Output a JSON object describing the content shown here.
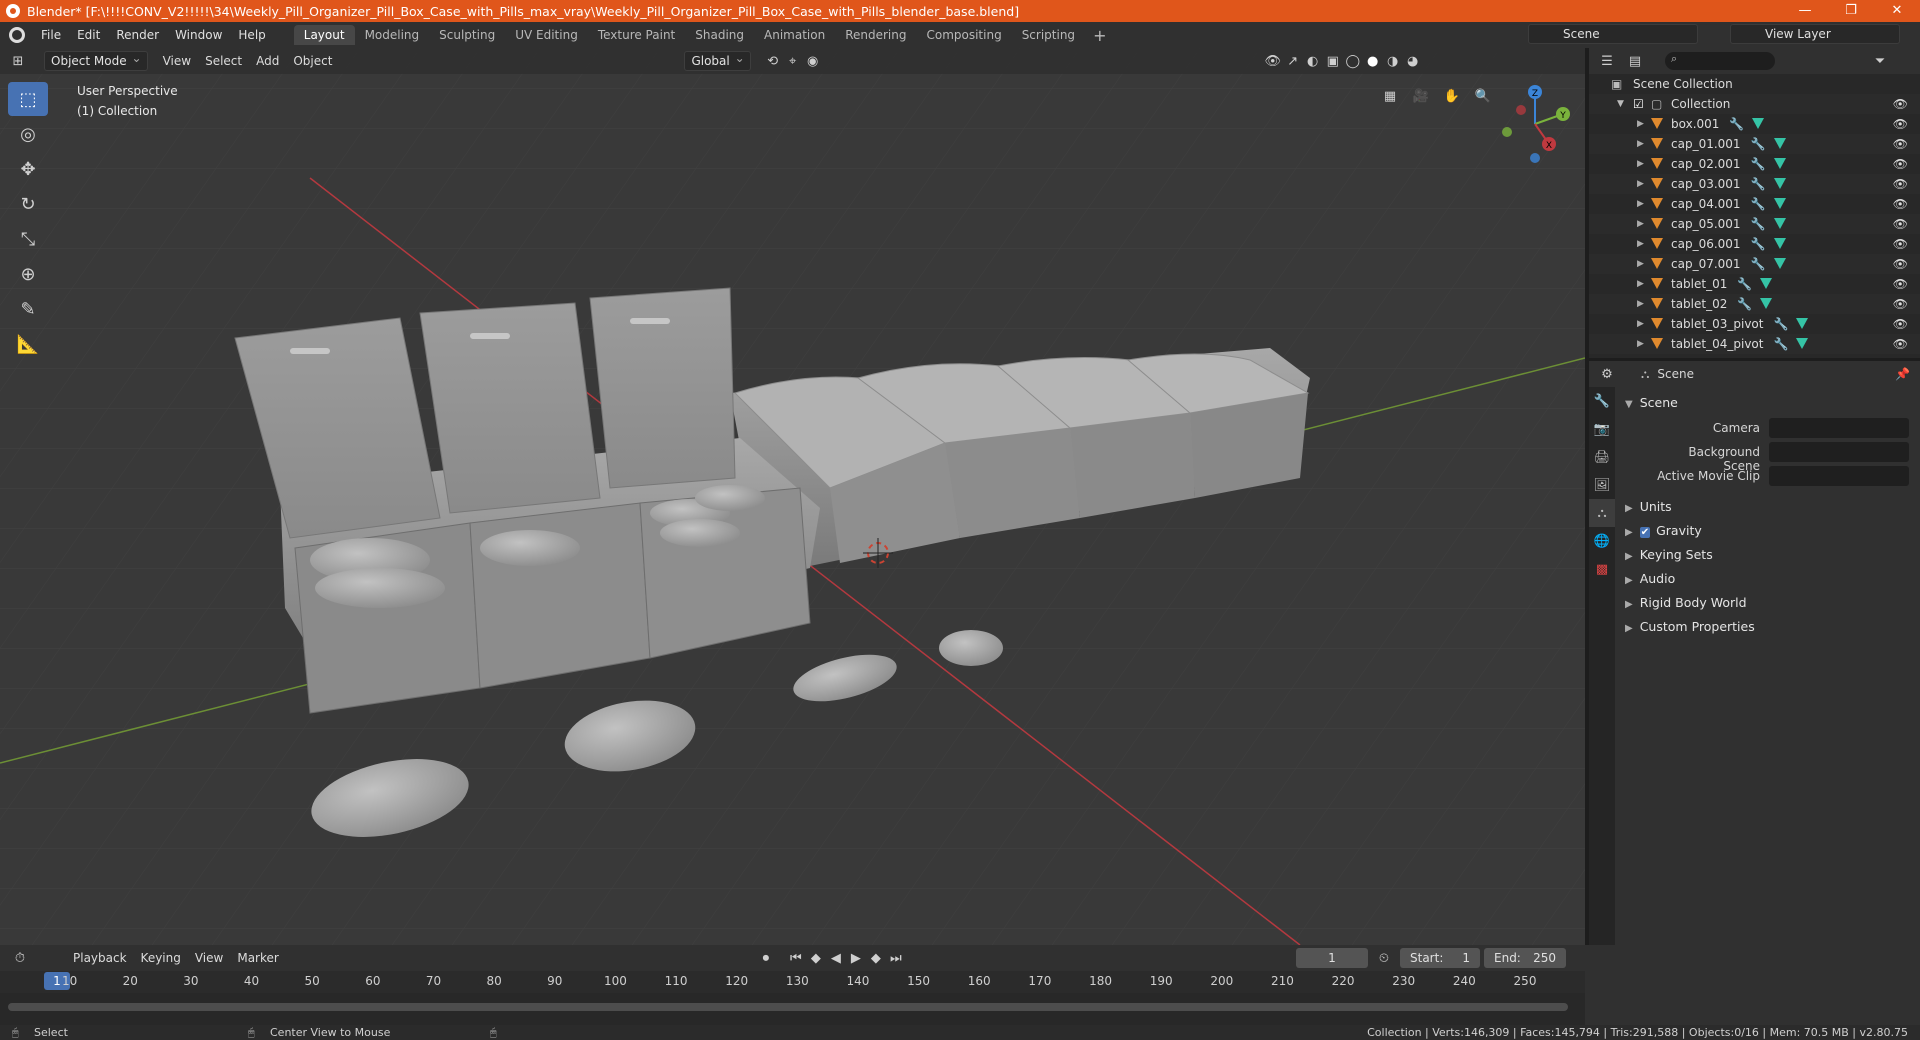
{
  "window": {
    "title": "Blender* [F:\\!!!!CONV_V2!!!!!\\34\\Weekly_Pill_Organizer_Pill_Box_Case_with_Pills_max_vray\\Weekly_Pill_Organizer_Pill_Box_Case_with_Pills_blender_base.blend]",
    "minimize": "—",
    "maximize": "❐",
    "close": "✕"
  },
  "menus": [
    "File",
    "Edit",
    "Render",
    "Window",
    "Help"
  ],
  "workspaces": [
    "Layout",
    "Modeling",
    "Sculpting",
    "UV Editing",
    "Texture Paint",
    "Shading",
    "Animation",
    "Rendering",
    "Compositing",
    "Scripting"
  ],
  "active_workspace": "Layout",
  "scene_name": "Scene",
  "view_layer": "View Layer",
  "viewport": {
    "mode": "Object Mode",
    "menus": [
      "View",
      "Select",
      "Add",
      "Object"
    ],
    "orientation": "Global",
    "info_line1": "User Perspective",
    "info_line2": "(1) Collection",
    "gizmo": {
      "x": "X",
      "y": "Y",
      "z": "Z"
    }
  },
  "tools": [
    {
      "name": "select-box-tool",
      "glyph": "⬚"
    },
    {
      "name": "cursor-tool",
      "glyph": "◎"
    },
    {
      "name": "move-tool",
      "glyph": "✥"
    },
    {
      "name": "rotate-tool",
      "glyph": "↻"
    },
    {
      "name": "scale-tool",
      "glyph": "⤡"
    },
    {
      "name": "transform-tool",
      "glyph": "⊕"
    },
    {
      "name": "annotate-tool",
      "glyph": "✎"
    },
    {
      "name": "measure-tool",
      "glyph": "📐"
    }
  ],
  "outliner": {
    "root": "Scene Collection",
    "collection": "Collection",
    "objects": [
      "box.001",
      "cap_01.001",
      "cap_02.001",
      "cap_03.001",
      "cap_04.001",
      "cap_05.001",
      "cap_06.001",
      "cap_07.001",
      "tablet_01",
      "tablet_02",
      "tablet_03_pivot",
      "tablet_04_pivot"
    ]
  },
  "properties": {
    "context": "Scene",
    "panel": "Scene",
    "camera_label": "Camera",
    "background_label": "Background Scene",
    "movieclip_label": "Active Movie Clip",
    "subpanels": [
      "Units",
      "Gravity",
      "Keying Sets",
      "Audio",
      "Rigid Body World",
      "Custom Properties"
    ],
    "gravity_checked": true
  },
  "timeline": {
    "menus": [
      "Playback",
      "Keying",
      "View",
      "Marker"
    ],
    "current_frame": "1",
    "start_label": "Start:",
    "start": "1",
    "end_label": "End:",
    "end": "250",
    "ticks": [
      "10",
      "20",
      "30",
      "40",
      "50",
      "60",
      "70",
      "80",
      "90",
      "100",
      "110",
      "120",
      "130",
      "140",
      "150",
      "160",
      "170",
      "180",
      "190",
      "200",
      "210",
      "220",
      "230",
      "240",
      "250"
    ],
    "playhead": "1"
  },
  "status": {
    "left": "Select",
    "middle": "Center View to Mouse",
    "right": "Collection | Verts:146,309 | Faces:145,794 | Tris:291,588 | Objects:0/16 | Mem: 70.5 MB | v2.80.75"
  },
  "colors": {
    "accent": "#4772b3",
    "titlebar": "#e0561b",
    "axis_x": "#c0393f",
    "axis_y": "#7ab33c",
    "axis_z": "#3b85d8"
  }
}
